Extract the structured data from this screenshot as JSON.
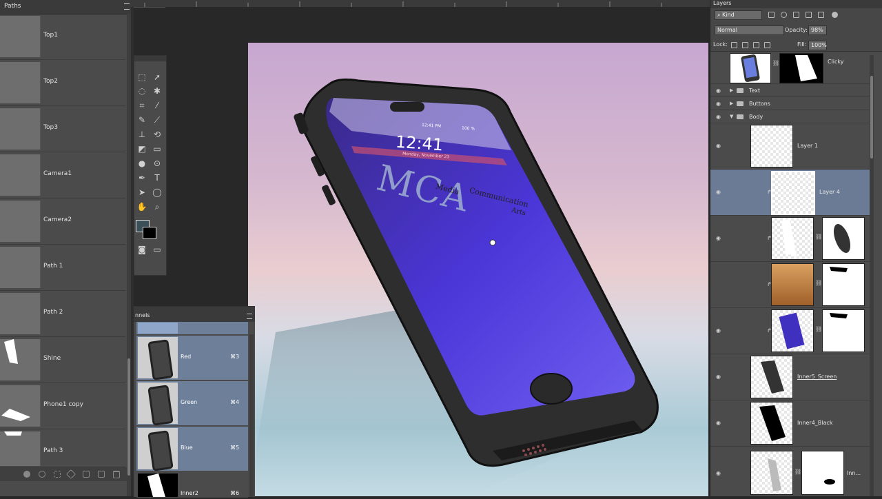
{
  "paths_panel": {
    "tab": "Paths",
    "items": [
      {
        "label": "Top1"
      },
      {
        "label": "Top2"
      },
      {
        "label": "Top3"
      },
      {
        "label": "Camera1"
      },
      {
        "label": "Camera2"
      },
      {
        "label": "Path 1"
      },
      {
        "label": "Path 2"
      },
      {
        "label": "Shine"
      },
      {
        "label": "Phone1 copy"
      },
      {
        "label": "Path 3"
      }
    ]
  },
  "channels_panel": {
    "tab": "nnels",
    "items": [
      {
        "label": "Red",
        "shortcut": "⌘3"
      },
      {
        "label": "Green",
        "shortcut": "⌘4"
      },
      {
        "label": "Blue",
        "shortcut": "⌘5"
      },
      {
        "label": "Inner2",
        "shortcut": "⌘6"
      }
    ]
  },
  "canvas": {
    "screen_time": "12:41",
    "screen_date": "Monday, November 23",
    "logo_text": "MCA",
    "logo_sub1": "Media",
    "logo_sub2": "Communication",
    "logo_sub3": "Arts",
    "status_time": "12:41 PM",
    "status_battery": "100 %"
  },
  "layers_panel": {
    "tab": "Layers",
    "filter_kind": "Kind",
    "blend_mode": "Normal",
    "opacity_label": "Opacity:",
    "opacity_value": "98%",
    "lock_label": "Lock:",
    "fill_label": "Fill:",
    "fill_value": "100%",
    "layers": [
      {
        "name": "Clicky"
      },
      {
        "name": "Text"
      },
      {
        "name": "Buttons"
      },
      {
        "name": "Body"
      },
      {
        "name": "Layer 1"
      },
      {
        "name": "Layer 4"
      },
      {
        "name": ""
      },
      {
        "name": ""
      },
      {
        "name": ""
      },
      {
        "name": "Inner5_Screen"
      },
      {
        "name": "Inner4_Black"
      },
      {
        "name": "Inn..."
      }
    ]
  },
  "colors": {
    "foreground": "#3b4f58",
    "background": "#000000",
    "selection": "#6b7b96"
  }
}
